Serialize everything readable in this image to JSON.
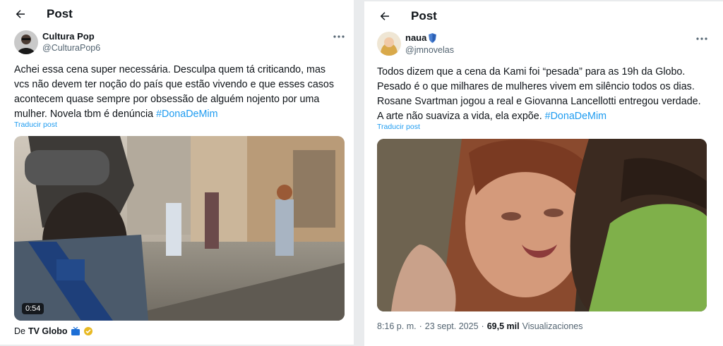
{
  "left_post": {
    "header_title": "Post",
    "author_name": "Cultura Pop",
    "author_handle": "@CulturaPop6",
    "text_line1": "Achei essa cena super necessária. Desculpa quem tá criticando, mas",
    "text_line2": "vcs não devem ter noção do país que estão vivendo e que esses casos",
    "text_line3": "acontecem quase sempre por obsessão de alguém nojento por uma",
    "text_line4_prefix": "mulher. Novela tbm é denúncia ",
    "hashtag": "#DonaDeMim",
    "translate": "Traducir post",
    "video_duration": "0:54",
    "source_prefix": "De",
    "source_name": "TV Globo",
    "icons": [
      "arrow-left-icon",
      "more-icon",
      "tv-icon",
      "verified-badge-icon"
    ]
  },
  "right_post": {
    "header_title": "Post",
    "author_name": "naua",
    "author_handle": "@jmnovelas",
    "text_line1": "Todos dizem que a cena da Kami foi “pesada” para as 19h da Globo.",
    "text_line2": "Pesado é o que milhares de mulheres vivem em silêncio todos os dias.",
    "text_line3": "Rosane Svartman jogou a real e Giovanna Lancellotti entregou verdade.",
    "text_line4_prefix": "A arte não suaviza a vida, ela expõe. ",
    "hashtag": "#DonaDeMim",
    "translate": "Traducir post",
    "time": "8:16 p. m.",
    "sep": "·",
    "date": "23 sept. 2025",
    "views_count": "69,5 mil",
    "views_label": "Visualizaciones",
    "icons": [
      "arrow-left-icon",
      "more-icon",
      "shield-badge-icon"
    ]
  },
  "colors": {
    "accent": "#1d9bf0",
    "secondary_text": "#536471"
  }
}
